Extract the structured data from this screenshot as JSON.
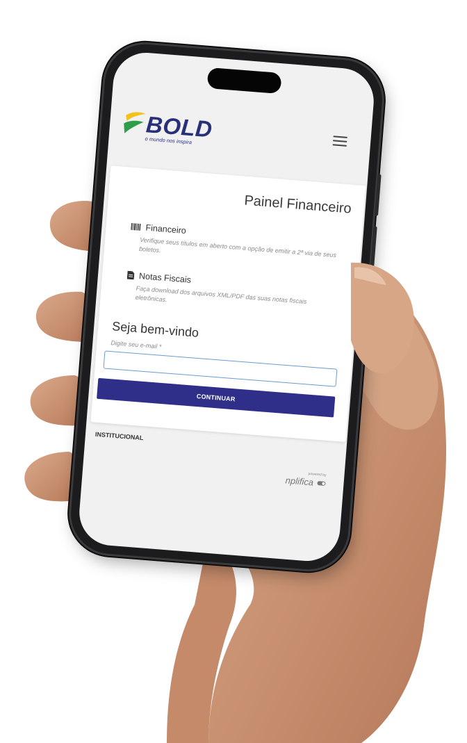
{
  "brand": {
    "name": "BOLD",
    "tagline": "o mundo nos inspira",
    "colors": {
      "navy": "#28307a",
      "yellow": "#f4c21a",
      "green": "#2e9e48"
    }
  },
  "header": {
    "menu_icon": "hamburger-icon"
  },
  "panel": {
    "title": "Painel Financeiro",
    "features": [
      {
        "icon": "barcode-icon",
        "title": "Financeiro",
        "description": "Verifique seus títulos em aberto com a opção de emitir a 2ª via de seus boletos."
      },
      {
        "icon": "document-icon",
        "title": "Notas Fiscais",
        "description": "Faça download dos arquivos XML/PDF das suas notas fiscais eletrônicas."
      }
    ],
    "welcome": "Seja bem-vindo",
    "email_label": "Digite seu e-mail *",
    "email_value": "",
    "continue_label": "CONTINUAR"
  },
  "footer": {
    "institutional": "INSTITUCIONAL",
    "powered_small": "powered by",
    "powered_brand": "nplifica"
  },
  "colors": {
    "button": "#2f2f8a",
    "input_border": "#6a9ad0"
  }
}
